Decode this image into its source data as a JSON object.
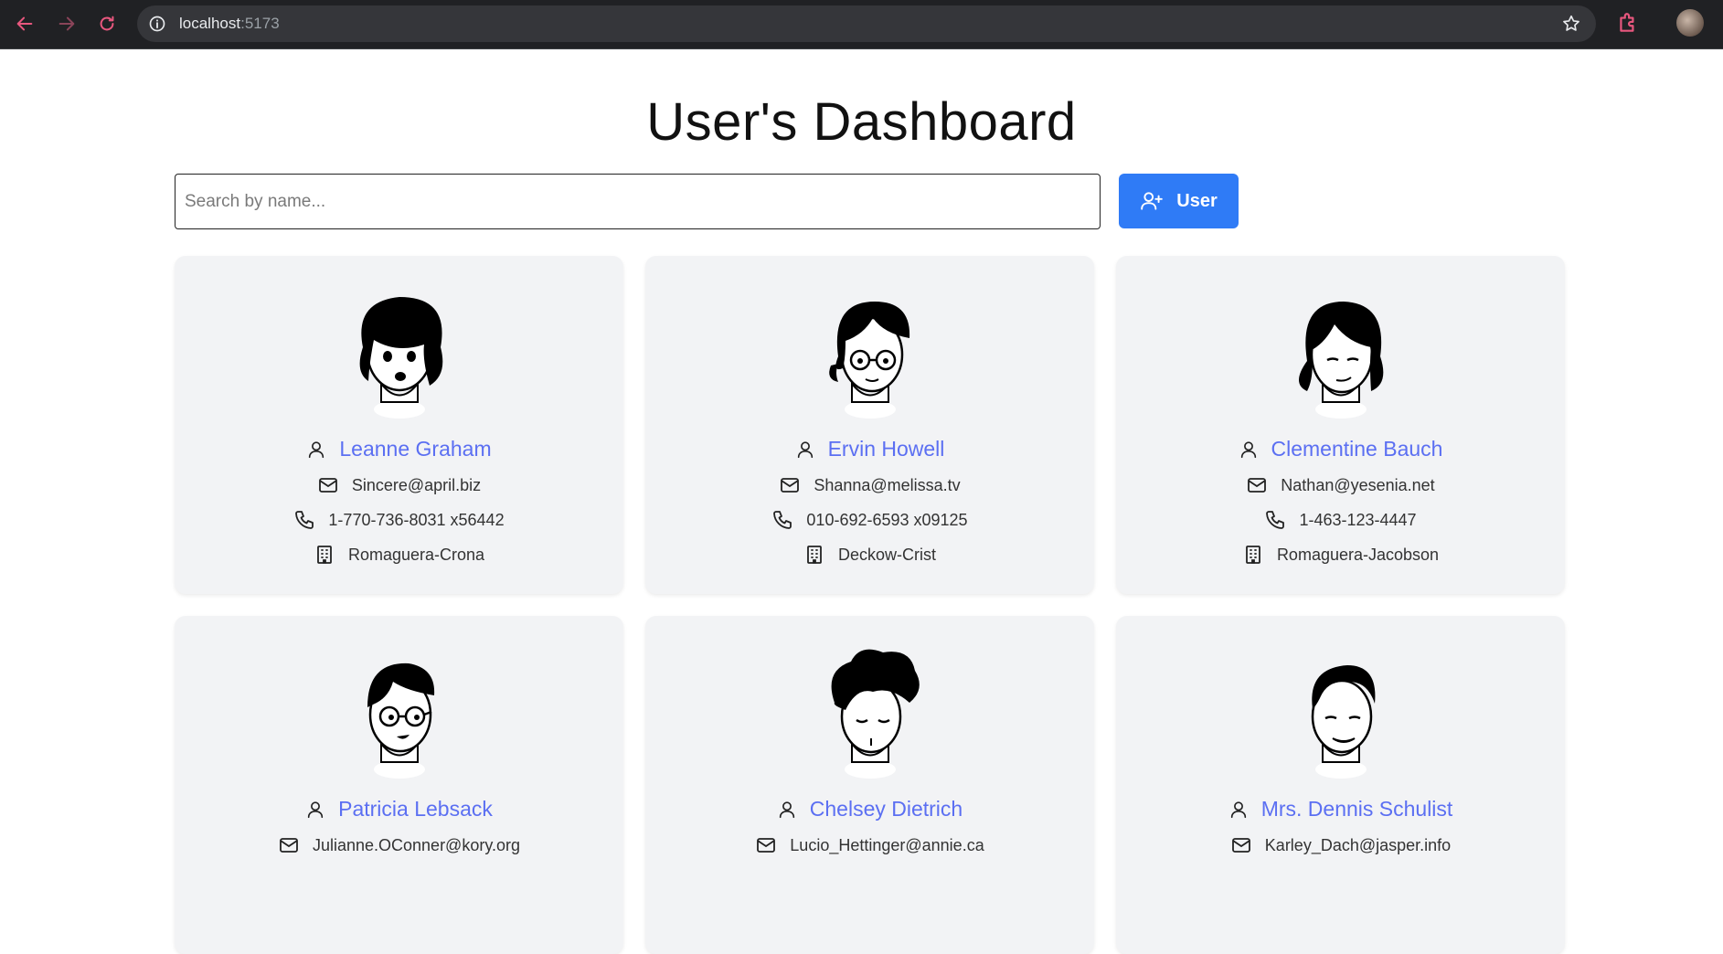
{
  "browser": {
    "url_host": "localhost",
    "url_port": ":5173",
    "icons": [
      "back-icon",
      "forward-icon",
      "reload-icon",
      "info-icon",
      "star-icon",
      "extension-icon",
      "profile-avatar"
    ]
  },
  "page": {
    "title": "User's Dashboard",
    "search_placeholder": "Search by name...",
    "add_button_label": "User"
  },
  "colors": {
    "accent": "#2f7bf6",
    "name": "#5b6ff2",
    "card_bg": "#f2f3f5"
  },
  "users": [
    {
      "name": "Leanne Graham",
      "email": "Sincere@april.biz",
      "phone": "1-770-736-8031 x56442",
      "company": "Romaguera-Crona"
    },
    {
      "name": "Ervin Howell",
      "email": "Shanna@melissa.tv",
      "phone": "010-692-6593 x09125",
      "company": "Deckow-Crist"
    },
    {
      "name": "Clementine Bauch",
      "email": "Nathan@yesenia.net",
      "phone": "1-463-123-4447",
      "company": "Romaguera-Jacobson"
    },
    {
      "name": "Patricia Lebsack",
      "email": "Julianne.OConner@kory.org",
      "phone": "",
      "company": ""
    },
    {
      "name": "Chelsey Dietrich",
      "email": "Lucio_Hettinger@annie.ca",
      "phone": "",
      "company": ""
    },
    {
      "name": "Mrs. Dennis Schulist",
      "email": "Karley_Dach@jasper.info",
      "phone": "",
      "company": ""
    }
  ]
}
